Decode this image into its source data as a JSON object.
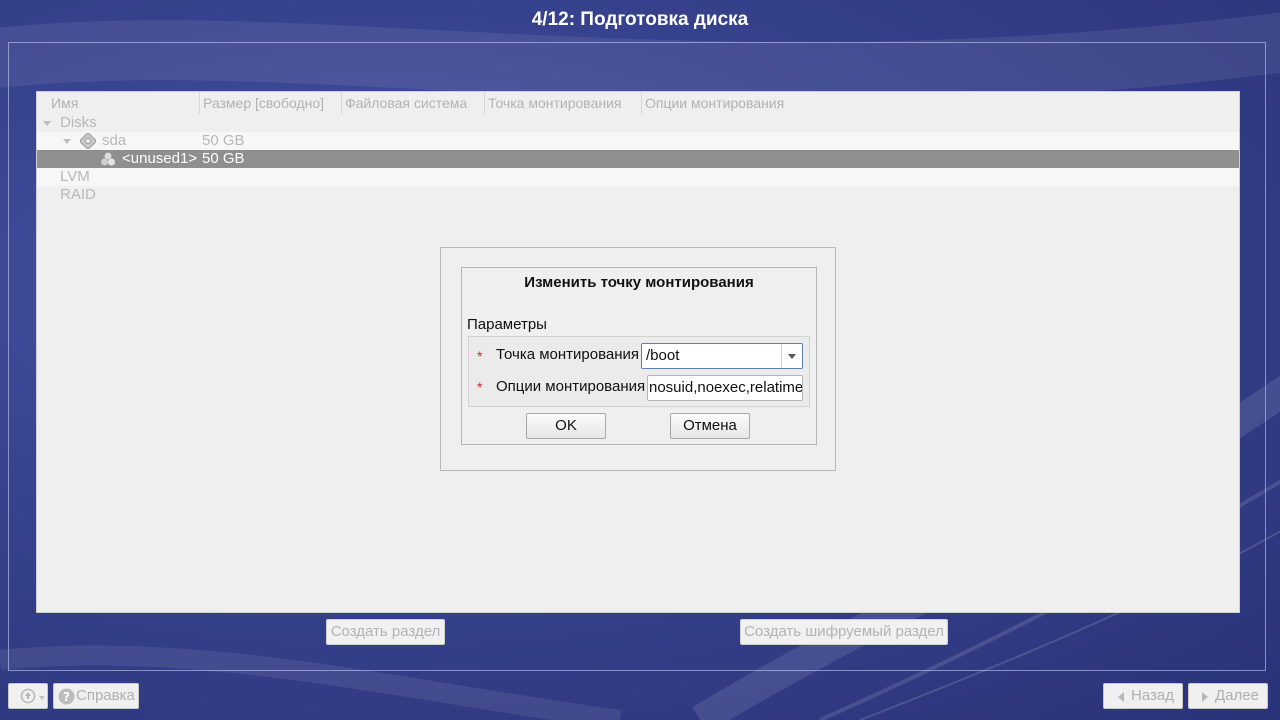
{
  "window": {
    "title": "4/12: Подготовка диска"
  },
  "table": {
    "columns": [
      "Имя",
      "Размер [свободно]",
      "Файловая система",
      "Точка монтирования",
      "Опции монтирования"
    ],
    "rows": [
      {
        "name": "Disks",
        "size": ""
      },
      {
        "name": "sda",
        "size": "50 GB",
        "icon": "disk-icon"
      },
      {
        "name": "<unused1>",
        "size": "50 GB",
        "icon": "partition-icon",
        "selected": true
      },
      {
        "name": "LVM",
        "size": ""
      },
      {
        "name": "RAID",
        "size": ""
      }
    ]
  },
  "dialog": {
    "title": "Изменить точку монтирования",
    "section": "Параметры",
    "required_mark": "*",
    "mount_point_label": "Точка монтирования",
    "mount_point_value": "/boot",
    "mount_options_label": "Опции монтирования",
    "mount_options_value": "nosuid,noexec,relatime",
    "ok_label": "OK",
    "cancel_label": "Отмена"
  },
  "actions": {
    "create_partition": "Создать раздел",
    "create_encrypted_partition": "Создать шифруемый раздел"
  },
  "footer": {
    "help_label": "Справка",
    "back_label": "Назад",
    "next_label": "Далее"
  },
  "colors": {
    "background": "#37428e",
    "selected_row": "#8f8f8f",
    "required_mark": "#d9252b",
    "focus_border": "#5a7fb5"
  }
}
